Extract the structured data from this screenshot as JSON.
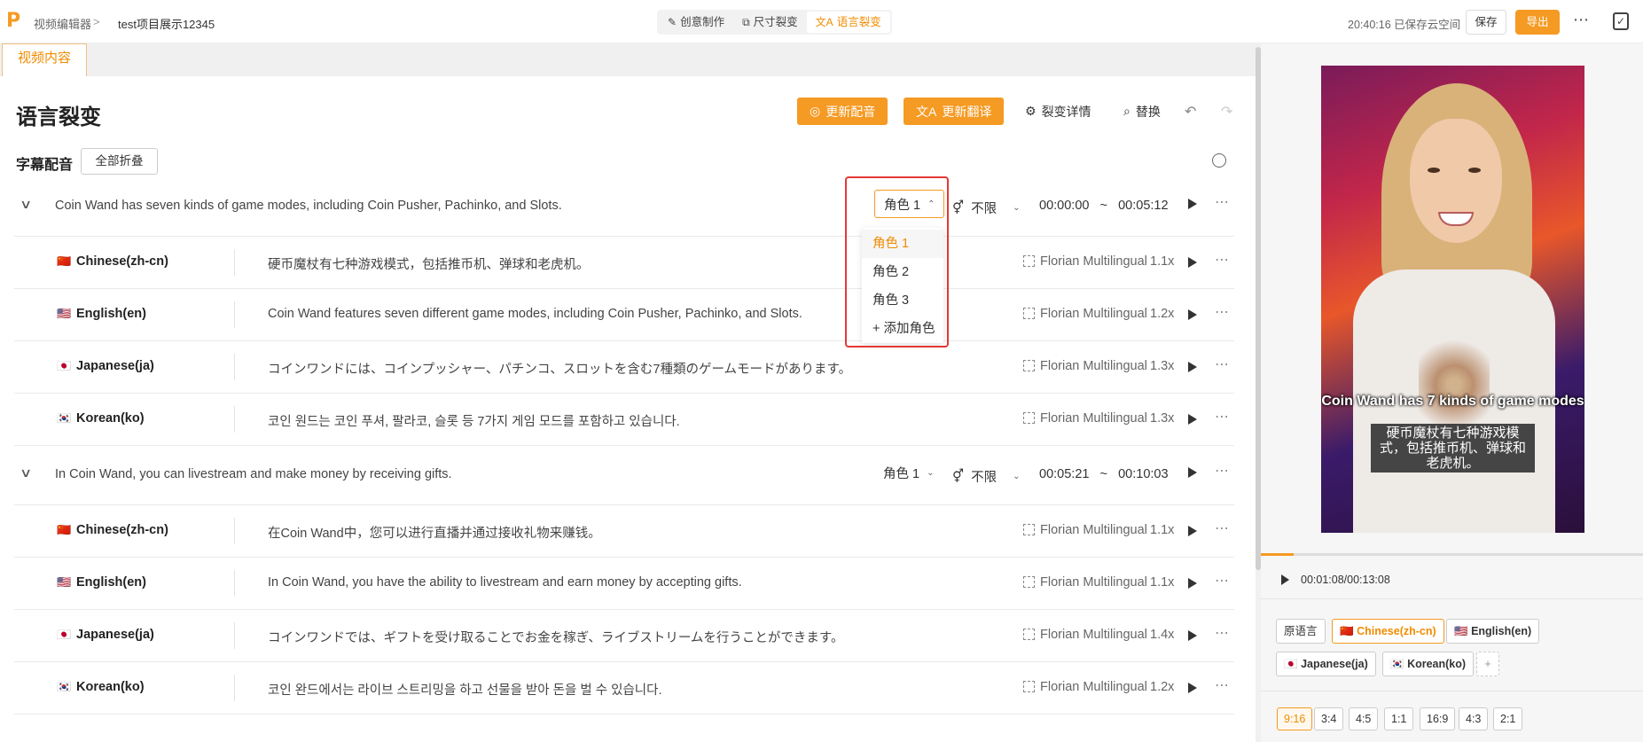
{
  "topbar": {
    "logo": "P",
    "crumb_root": "视频编辑器",
    "crumb_sep": ">",
    "project": "test项目展示12345",
    "modes": [
      {
        "icon": "✎",
        "label": "创意制作"
      },
      {
        "icon": "⧉",
        "label": "尺寸裂变"
      },
      {
        "icon": "文A",
        "label": "语言裂变"
      }
    ],
    "save_status": "20:40:16 已保存云空间",
    "save_label": "保存",
    "export_label": "导出",
    "more": "⋯"
  },
  "tabs": {
    "video_content": "视频内容"
  },
  "header": {
    "title": "语言裂变",
    "update_dub": "更新配音",
    "update_translate": "更新翻译",
    "details": "裂变详情",
    "replace": "替换",
    "undo": "↶",
    "redo": "↷"
  },
  "subtitle_section": {
    "title": "字幕配音",
    "fold_all": "全部折叠"
  },
  "groups": [
    {
      "source": "Coin Wand has seven kinds of game modes, including Coin Pusher, Pachinko, and Slots.",
      "role": "角色 1",
      "role_arrow": "⌃",
      "gender": "不限",
      "start": "00:00:00",
      "tilde": "~",
      "end": "00:05:12",
      "langs": [
        {
          "flag": "🇨🇳",
          "name": "Chinese(zh-cn)",
          "text": "硬币魔杖有七种游戏模式，包括推币机、弹球和老虎机。",
          "voice": "Florian Multilingual",
          "speed": "1.1x"
        },
        {
          "flag": "🇺🇸",
          "name": "English(en)",
          "text": "Coin Wand features seven different game modes, including Coin Pusher, Pachinko, and Slots.",
          "voice": "Florian Multilingual",
          "speed": "1.2x"
        },
        {
          "flag": "🇯🇵",
          "name": "Japanese(ja)",
          "text": "コインワンドには、コインプッシャー、パチンコ、スロットを含む7種類のゲームモードがあります。",
          "voice": "Florian Multilingual",
          "speed": "1.3x"
        },
        {
          "flag": "🇰🇷",
          "name": "Korean(ko)",
          "text": "코인 원드는 코인 푸셔, 팔라코, 슬롯 등 7가지 게임 모드를 포함하고 있습니다.",
          "voice": "Florian Multilingual",
          "speed": "1.3x"
        }
      ]
    },
    {
      "source": "In Coin Wand, you can livestream and make money by receiving gifts.",
      "role": "角色 1",
      "role_arrow": "⌄",
      "gender": "不限",
      "start": "00:05:21",
      "tilde": "~",
      "end": "00:10:03",
      "langs": [
        {
          "flag": "🇨🇳",
          "name": "Chinese(zh-cn)",
          "text": "在Coin Wand中，您可以进行直播并通过接收礼物来赚钱。",
          "voice": "Florian Multilingual",
          "speed": "1.1x"
        },
        {
          "flag": "🇺🇸",
          "name": "English(en)",
          "text": "In Coin Wand, you have the ability to livestream and earn money by accepting gifts.",
          "voice": "Florian Multilingual",
          "speed": "1.1x"
        },
        {
          "flag": "🇯🇵",
          "name": "Japanese(ja)",
          "text": "コインワンドでは、ギフトを受け取ることでお金を稼ぎ、ライブストリームを行うことができます。",
          "voice": "Florian Multilingual",
          "speed": "1.4x"
        },
        {
          "flag": "🇰🇷",
          "name": "Korean(ko)",
          "text": "코인 완드에서는 라이브 스트리밍을 하고 선물을 받아 돈을 벌 수 있습니다.",
          "voice": "Florian Multilingual",
          "speed": "1.2x"
        }
      ]
    }
  ],
  "role_dropdown": {
    "options": [
      "角色 1",
      "角色 2",
      "角色 3",
      "+ 添加角色"
    ],
    "selected": "角色 1"
  },
  "preview": {
    "caption_en": "Coin Wand has 7 kinds of game modes",
    "caption_zh": "硬币魔杖有七种游戏模式，包括推币机、弹球和老虎机。",
    "time": "00:01:08/00:13:08",
    "progress": 0.087
  },
  "language_chips": [
    {
      "label": "原语言",
      "flag": ""
    },
    {
      "label": "Chinese(zh-cn)",
      "flag": "🇨🇳",
      "active": true
    },
    {
      "label": "English(en)",
      "flag": "🇺🇸"
    },
    {
      "label": "Japanese(ja)",
      "flag": "🇯🇵"
    },
    {
      "label": "Korean(ko)",
      "flag": "🇰🇷"
    }
  ],
  "add_chip": "+",
  "ratios": [
    "9:16",
    "3:4",
    "4:5",
    "1:1",
    "16:9",
    "4:3",
    "2:1"
  ],
  "active_ratio": "9:16",
  "colors": {
    "accent": "#f59a23",
    "highlight_box": "#e53935"
  }
}
